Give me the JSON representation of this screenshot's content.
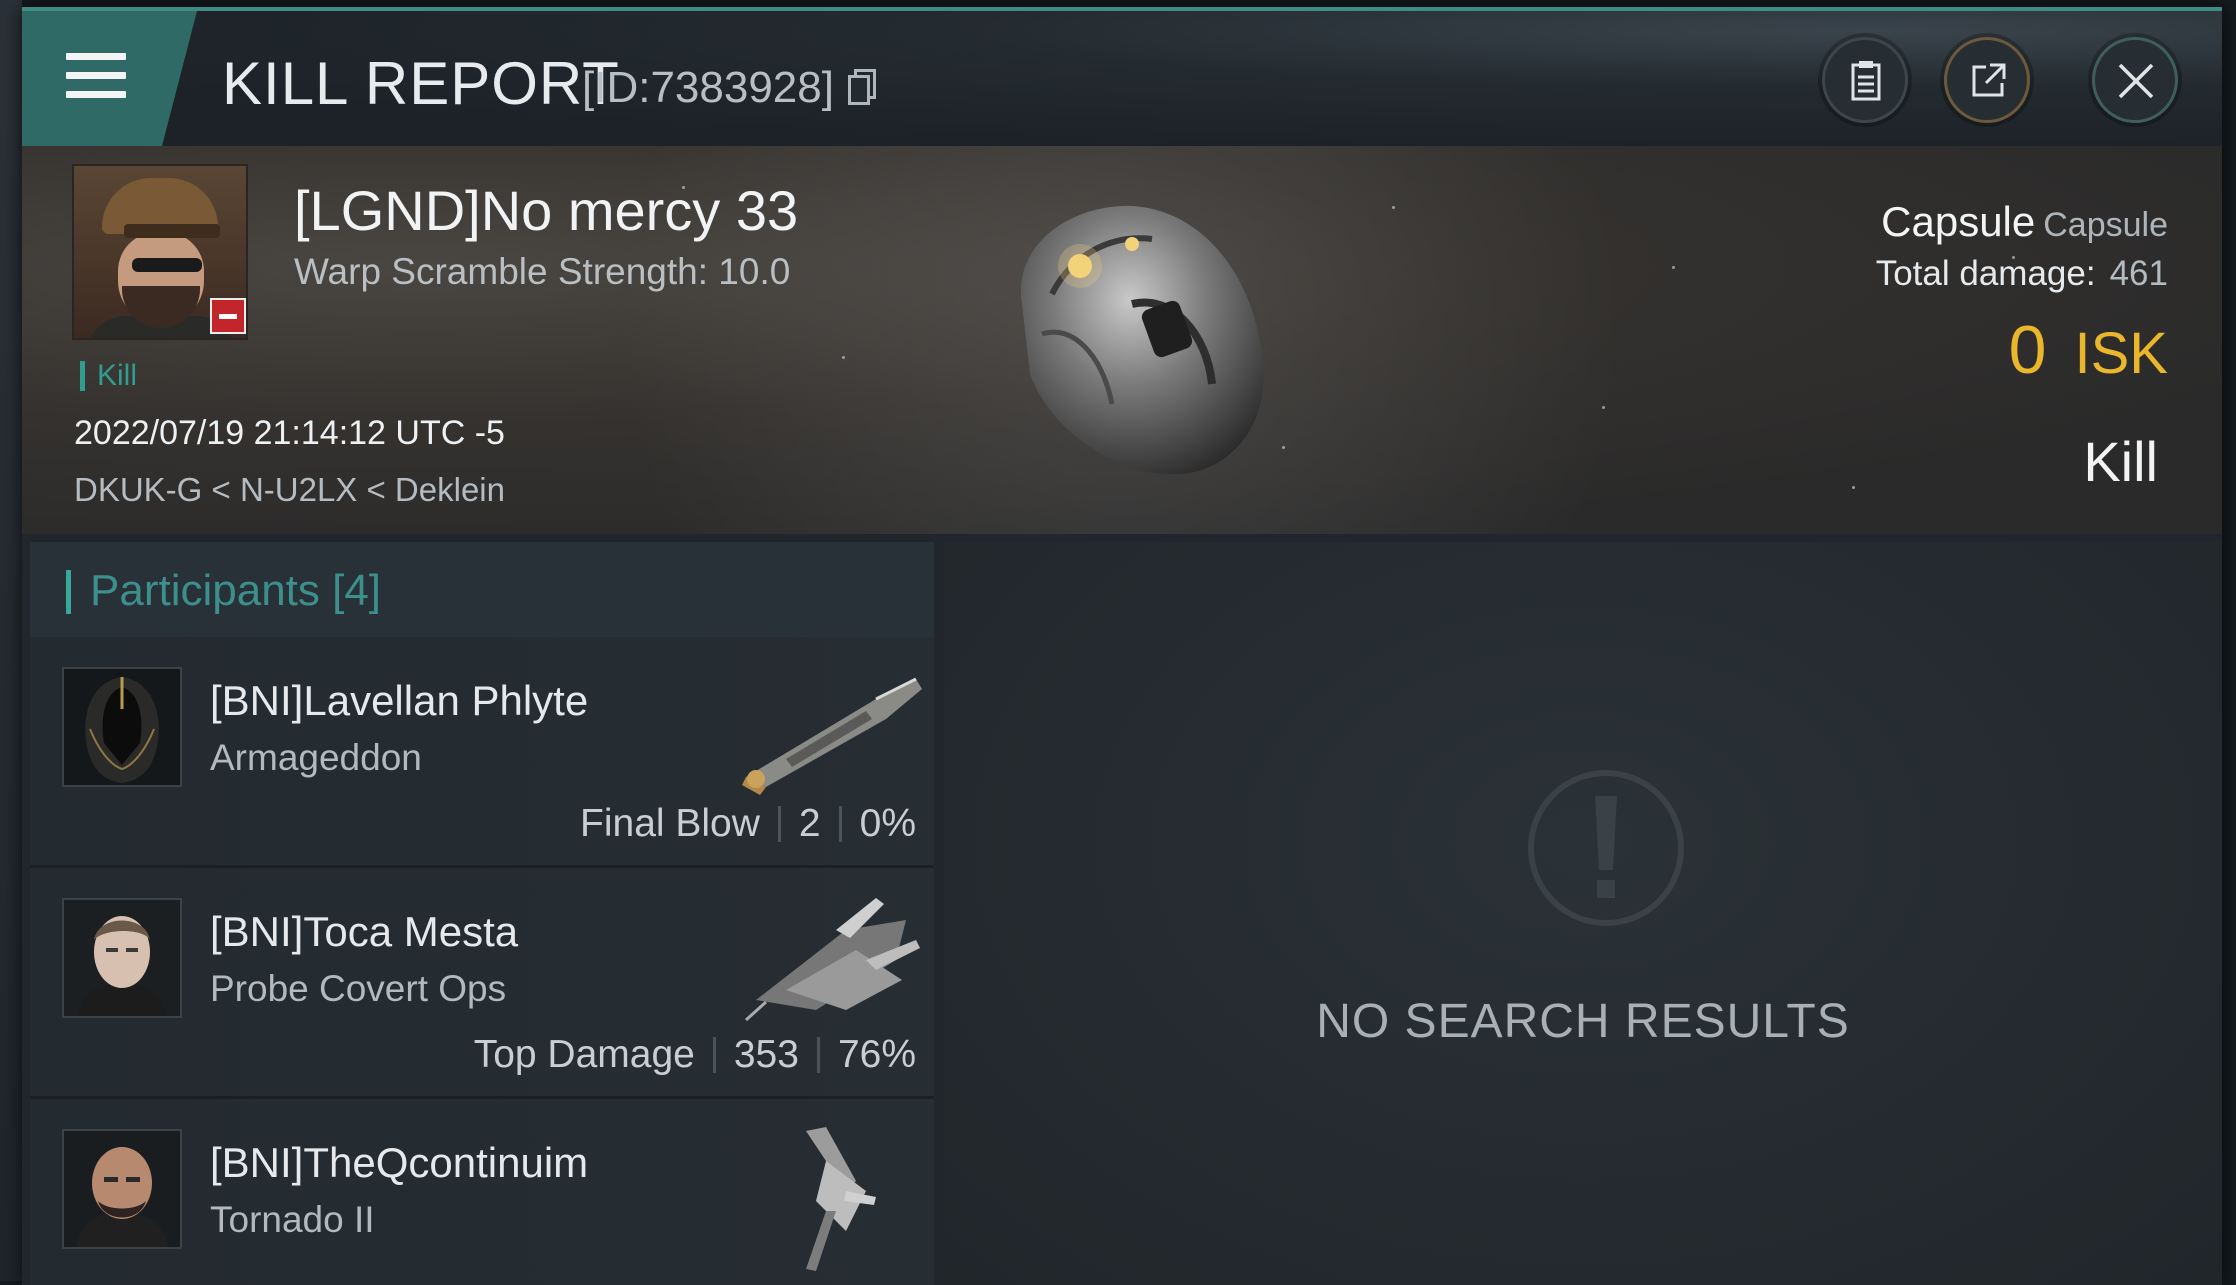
{
  "header": {
    "title": "KILL REPORT",
    "report_id": "[ID:7383928]",
    "icons": [
      "menu-icon",
      "copy-icon",
      "clipboard-icon",
      "share-icon",
      "close-icon"
    ]
  },
  "victim": {
    "name": "[LGND]No mercy 33",
    "warp_scramble": "Warp Scramble Strength: 10.0",
    "kill_tag": "Kill",
    "datetime": "2022/07/19 21:14:12 UTC -5",
    "location": "DKUK-G < N-U2LX < Deklein",
    "ship_name": "Capsule",
    "ship_class": "Capsule",
    "total_damage_label": "Total damage:",
    "total_damage_value": "461",
    "isk_value": "0",
    "isk_unit": "ISK",
    "result": "Kill"
  },
  "participants": {
    "title": "Participants [4]",
    "items": [
      {
        "name": "[BNI]Lavellan Phlyte",
        "ship": "Armageddon",
        "role": "Final Blow",
        "damage": "2",
        "percent": "0%",
        "badge": "none"
      },
      {
        "name": "[BNI]Toca Mesta",
        "ship": "Probe Covert Ops",
        "role": "Top Damage",
        "damage": "353",
        "percent": "76%",
        "badge": "green-star"
      },
      {
        "name": "[BNI]TheQcontinuim",
        "ship": "Tornado II",
        "role": "",
        "damage": "",
        "percent": "",
        "badge": "purple-person"
      }
    ]
  },
  "results": {
    "empty_text": "NO SEARCH RESULTS"
  },
  "colors": {
    "accent": "#3f8c86",
    "isk": "#e9b62c",
    "kill_tag": "#2f9d8f",
    "minus_badge": "#c2262b"
  }
}
